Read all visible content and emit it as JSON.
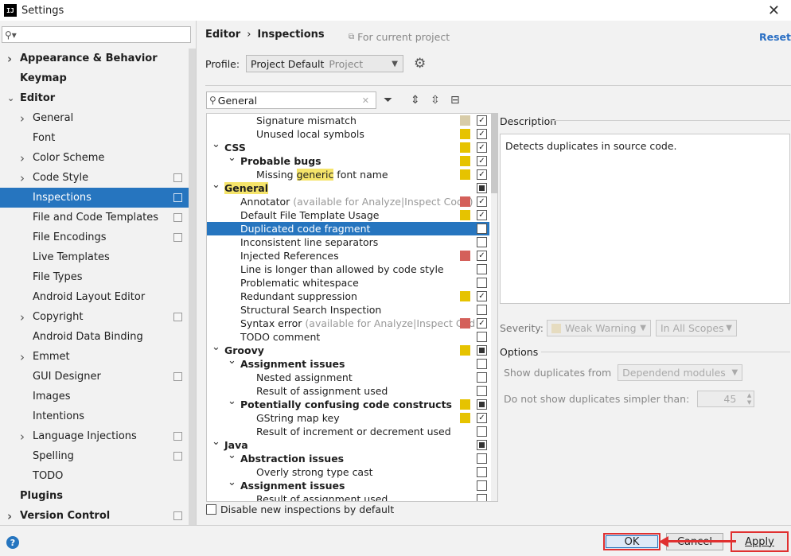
{
  "window": {
    "title": "Settings",
    "app_icon": "IJ"
  },
  "sidebar": {
    "search_placeholder": "",
    "items": [
      {
        "label": "Appearance & Behavior",
        "bold": true,
        "arrow": "collapsed",
        "indent": 0
      },
      {
        "label": "Keymap",
        "bold": true,
        "indent": 0
      },
      {
        "label": "Editor",
        "bold": true,
        "arrow": "expanded",
        "indent": 0
      },
      {
        "label": "General",
        "arrow": "collapsed",
        "indent": 1
      },
      {
        "label": "Font",
        "indent": 1
      },
      {
        "label": "Color Scheme",
        "arrow": "collapsed",
        "indent": 1
      },
      {
        "label": "Code Style",
        "arrow": "collapsed",
        "indent": 1,
        "copy": true
      },
      {
        "label": "Inspections",
        "indent": 1,
        "copy": true,
        "selected": true
      },
      {
        "label": "File and Code Templates",
        "indent": 1,
        "copy": true
      },
      {
        "label": "File Encodings",
        "indent": 1,
        "copy": true
      },
      {
        "label": "Live Templates",
        "indent": 1
      },
      {
        "label": "File Types",
        "indent": 1
      },
      {
        "label": "Android Layout Editor",
        "indent": 1
      },
      {
        "label": "Copyright",
        "arrow": "collapsed",
        "indent": 1,
        "copy": true
      },
      {
        "label": "Android Data Binding",
        "indent": 1
      },
      {
        "label": "Emmet",
        "arrow": "collapsed",
        "indent": 1
      },
      {
        "label": "GUI Designer",
        "indent": 1,
        "copy": true
      },
      {
        "label": "Images",
        "indent": 1
      },
      {
        "label": "Intentions",
        "indent": 1
      },
      {
        "label": "Language Injections",
        "arrow": "collapsed",
        "indent": 1,
        "copy": true
      },
      {
        "label": "Spelling",
        "indent": 1,
        "copy": true
      },
      {
        "label": "TODO",
        "indent": 1
      },
      {
        "label": "Plugins",
        "bold": true,
        "indent": 0
      },
      {
        "label": "Version Control",
        "bold": true,
        "arrow": "collapsed",
        "indent": 0,
        "copy": true
      }
    ]
  },
  "header": {
    "breadcrumb_1": "Editor",
    "breadcrumb_sep": "›",
    "breadcrumb_2": "Inspections",
    "for_current_project": "For current project",
    "reset": "Reset"
  },
  "profile": {
    "label": "Profile:",
    "value": "Project Default",
    "scope": "Project"
  },
  "filter": {
    "value": "General"
  },
  "inspections": [
    {
      "text": "Signature mismatch",
      "level": 3,
      "sev": "#d8cca8",
      "check": "checked"
    },
    {
      "text": "Unused local symbols",
      "level": 3,
      "sev": "#e6c300",
      "check": "checked"
    },
    {
      "text": "CSS",
      "level": 1,
      "bold": true,
      "arrow": true,
      "sev": "#e6c300",
      "check": "checked"
    },
    {
      "text": "Probable bugs",
      "level": 2,
      "bold": true,
      "arrow": true,
      "sev": "#e6c300",
      "check": "checked"
    },
    {
      "text_pre": "Missing ",
      "text_hl": "generic",
      "text_post": " font name",
      "level": 3,
      "sev": "#e6c300",
      "check": "checked"
    },
    {
      "text_hl": "General",
      "level": 1,
      "bold": true,
      "arrow": true,
      "check": "mixed"
    },
    {
      "text": "Annotator",
      "gray": " (available for Analyze|Inspect Code)",
      "level": 2,
      "sev": "#d4605a",
      "check": "checked"
    },
    {
      "text": "Default File Template Usage",
      "level": 2,
      "sev": "#e6c300",
      "check": "checked"
    },
    {
      "text": "Duplicated code fragment",
      "level": 2,
      "check": "empty",
      "selected": true
    },
    {
      "text": "Inconsistent line separators",
      "level": 2,
      "check": "empty"
    },
    {
      "text": "Injected References",
      "level": 2,
      "sev": "#d4605a",
      "check": "checked"
    },
    {
      "text": "Line is longer than allowed by code style",
      "level": 2,
      "check": "empty"
    },
    {
      "text": "Problematic whitespace",
      "level": 2,
      "check": "empty"
    },
    {
      "text": "Redundant suppression",
      "level": 2,
      "sev": "#e6c300",
      "check": "checked"
    },
    {
      "text": "Structural Search Inspection",
      "level": 2,
      "check": "empty"
    },
    {
      "text": "Syntax error",
      "gray": " (available for Analyze|Inspect Cod",
      "level": 2,
      "sev": "#d4605a",
      "check": "checked"
    },
    {
      "text": "TODO comment",
      "level": 2,
      "check": "empty"
    },
    {
      "text": "Groovy",
      "level": 1,
      "bold": true,
      "arrow": true,
      "sev": "#e6c300",
      "check": "mixed"
    },
    {
      "text": "Assignment issues",
      "level": 2,
      "bold": true,
      "arrow": true,
      "check": "empty"
    },
    {
      "text": "Nested assignment",
      "level": 3,
      "check": "empty"
    },
    {
      "text": "Result of assignment used",
      "level": 3,
      "check": "empty"
    },
    {
      "text": "Potentially confusing code constructs",
      "level": 2,
      "bold": true,
      "arrow": true,
      "sev": "#e6c300",
      "check": "mixed"
    },
    {
      "text": "GString map key",
      "level": 3,
      "sev": "#e6c300",
      "check": "checked"
    },
    {
      "text": "Result of increment or decrement used",
      "level": 3,
      "check": "empty"
    },
    {
      "text": "Java",
      "level": 1,
      "bold": true,
      "arrow": true,
      "check": "mixed"
    },
    {
      "text": "Abstraction issues",
      "level": 2,
      "bold": true,
      "arrow": true,
      "check": "empty"
    },
    {
      "text": "Overly strong type cast",
      "level": 3,
      "check": "empty"
    },
    {
      "text": "Assignment issues",
      "level": 2,
      "bold": true,
      "arrow": true,
      "check": "empty"
    },
    {
      "text": "Result of assignment used",
      "level": 3,
      "check": "empty"
    }
  ],
  "disable_new": "Disable new inspections by default",
  "description": {
    "label": "Description",
    "text": "Detects duplicates in source code."
  },
  "severity": {
    "label": "Severity:",
    "value": "Weak Warning",
    "scope": "In All Scopes"
  },
  "options": {
    "label": "Options",
    "show_dup_label": "Show duplicates from",
    "show_dup_value": "Dependend modules",
    "simpler_label": "Do not show duplicates simpler than:",
    "simpler_value": "45"
  },
  "buttons": {
    "ok": "OK",
    "cancel": "Cancel",
    "apply": "Apply",
    "help": "?"
  }
}
